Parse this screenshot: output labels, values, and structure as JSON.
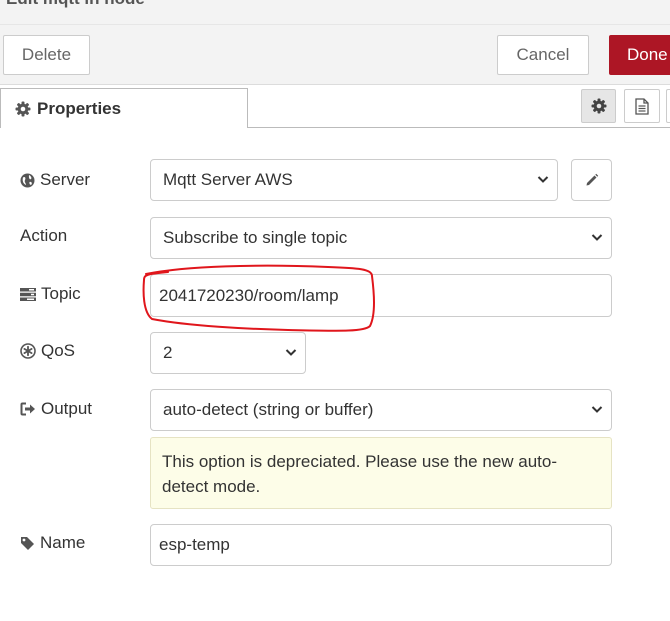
{
  "title": "Edit mqtt in node",
  "toolbar": {
    "delete_label": "Delete",
    "cancel_label": "Cancel",
    "done_label": "Done"
  },
  "tabs": {
    "properties_label": "Properties"
  },
  "form": {
    "server": {
      "label": "Server",
      "value": "Mqtt Server AWS"
    },
    "action": {
      "label": "Action",
      "value": "Subscribe to single topic"
    },
    "topic": {
      "label": "Topic",
      "value": "2041720230/room/lamp"
    },
    "qos": {
      "label": "QoS",
      "value": "2"
    },
    "output": {
      "label": "Output",
      "value": "auto-detect (string or buffer)",
      "warning": "This option is depreciated. Please use the new auto-detect mode."
    },
    "name": {
      "label": "Name",
      "value": "esp-temp"
    }
  },
  "colors": {
    "done_button": "#ad1625",
    "warning_background": "#fdfde8",
    "annotation_outline": "#e0161c"
  },
  "icons": {
    "properties_tab": "gear-icon",
    "server": "globe-icon",
    "topic": "tasks-icon",
    "qos": "asterisk-circle-icon",
    "output": "sign-out-icon",
    "name": "tag-icon",
    "edit_server": "pencil-icon",
    "description_tab": "file-text-icon"
  }
}
